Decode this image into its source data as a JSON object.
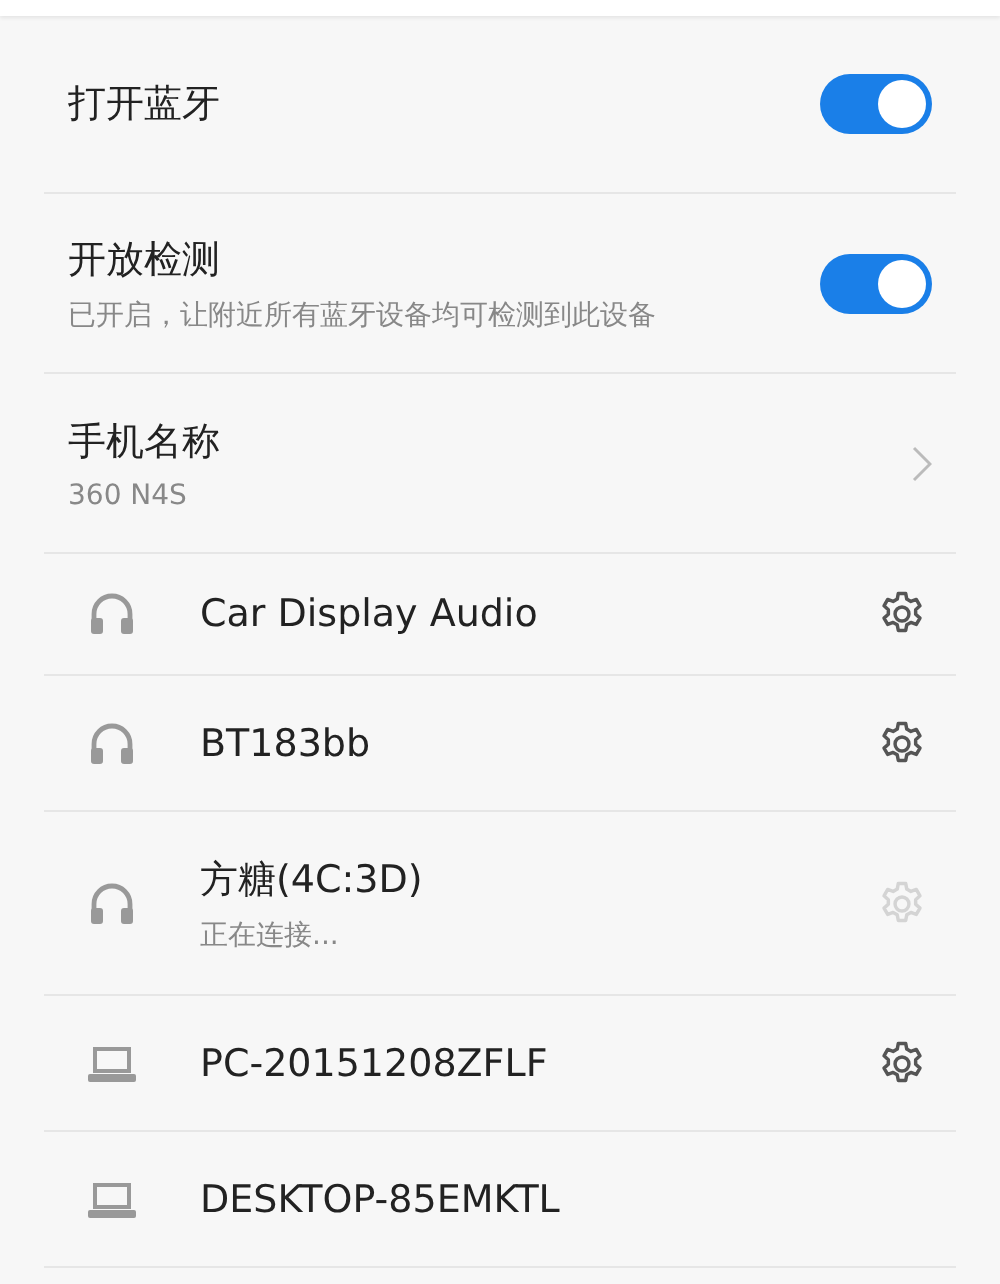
{
  "settings": [
    {
      "kind": "toggle",
      "title": "打开蓝牙",
      "on": true
    },
    {
      "kind": "toggle",
      "title": "开放检测",
      "subtitle": "已开启，让附近所有蓝牙设备均可检测到此设备",
      "on": true
    },
    {
      "kind": "link",
      "title": "手机名称",
      "subtitle": "360 N4S"
    }
  ],
  "devices": [
    {
      "kind": "headphones",
      "name": "Car Display Audio",
      "settings_button": true,
      "disabled": false
    },
    {
      "kind": "headphones",
      "name": "BT183bb",
      "settings_button": true,
      "disabled": false
    },
    {
      "kind": "headphones",
      "name": "方糖(4C:3D)",
      "status": "正在连接...",
      "settings_button": true,
      "disabled": true
    },
    {
      "kind": "laptop",
      "name": "PC-20151208ZFLF",
      "settings_button": true,
      "disabled": false
    },
    {
      "kind": "laptop",
      "name": "DESKTOP-85EMKTL",
      "settings_button": false
    }
  ]
}
